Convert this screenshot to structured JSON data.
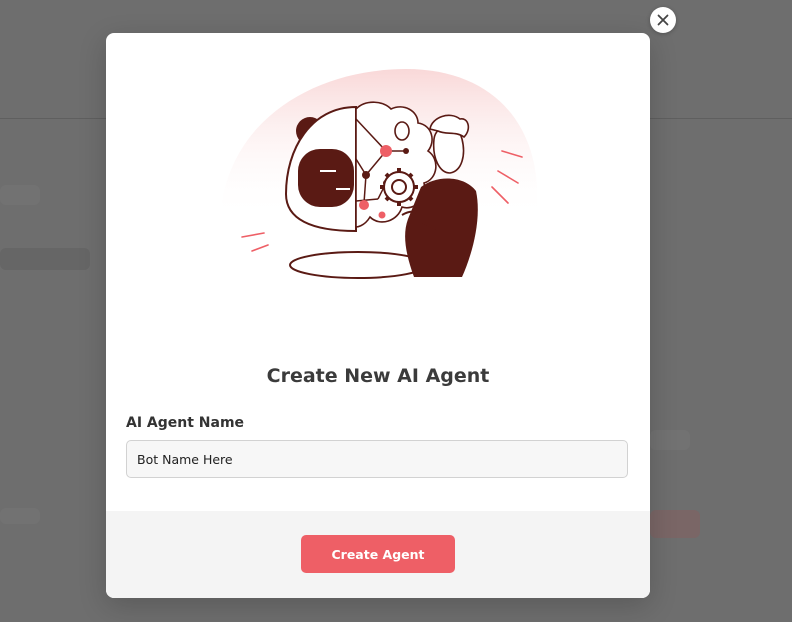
{
  "modal": {
    "title": "Create New AI Agent",
    "field_label": "AI Agent Name",
    "input_value": "Bot Name Here",
    "submit_label": "Create Agent"
  },
  "icons": {
    "close": "close-icon",
    "illustration": "robot-brain-person-illustration"
  },
  "colors": {
    "accent": "#ee5f66",
    "illustration_dark": "#5a1a14",
    "illustration_bg": "#fbe3e3"
  }
}
